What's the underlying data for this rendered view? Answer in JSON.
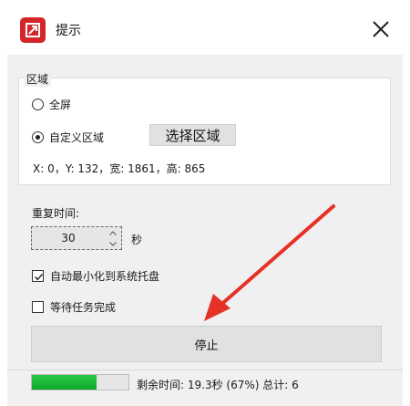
{
  "window": {
    "title": "提示",
    "app_icon": "app-logo-icon",
    "close_icon": "close-icon"
  },
  "region": {
    "legend": "区域",
    "options": [
      {
        "label": "全屏",
        "selected": false
      },
      {
        "label": "自定义区域",
        "selected": true
      }
    ],
    "select_button": "选择区域",
    "coords": "X: 0，Y: 132，宽: 1861，高: 865"
  },
  "repeat": {
    "label": "重复时间:",
    "value": "30",
    "unit": "秒"
  },
  "checks": [
    {
      "label": "自动最小化到系统托盘",
      "checked": true
    },
    {
      "label": "等待任务完成",
      "checked": false
    }
  ],
  "stop_button": "停止",
  "status": {
    "progress_percent": 67,
    "text": "剩余时间: 19.3秒 (67%) 总计: 6"
  },
  "colors": {
    "accent_red": "#d3262b",
    "arrow_red": "#e53226",
    "progress_green": "#1bb833"
  }
}
